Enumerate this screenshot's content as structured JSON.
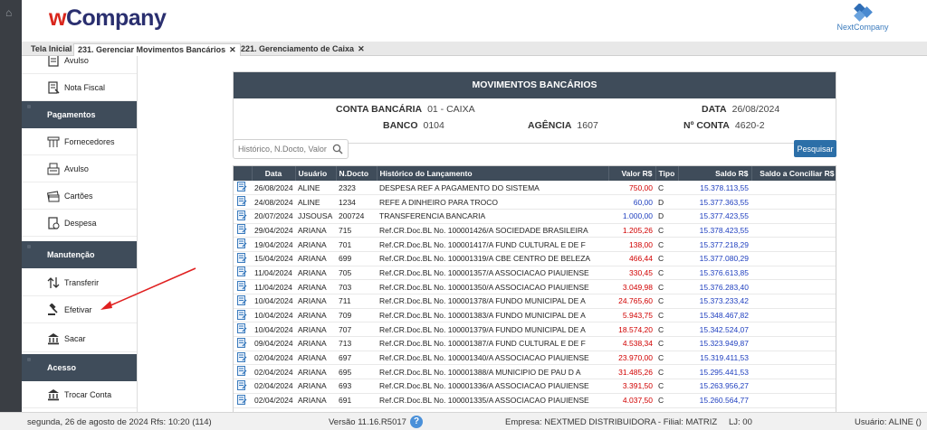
{
  "header": {
    "logo_w": "w",
    "logo_rest": "Company",
    "partner": "NextCompany"
  },
  "tabs": [
    {
      "label": "Tela Inicial"
    },
    {
      "label": "231. Gerenciar Movimentos Bancários",
      "close": "✕"
    },
    {
      "label": "221. Gerenciamento de Caixa",
      "close": "✕"
    }
  ],
  "sidebar": {
    "items": [
      {
        "label": "Avulso",
        "icon": "receipt-icon"
      },
      {
        "label": "Nota Fiscal",
        "icon": "invoice-icon"
      },
      {
        "label": "Pagamentos",
        "section": true
      },
      {
        "label": "Fornecedores",
        "icon": "supplier-icon"
      },
      {
        "label": "Avulso",
        "icon": "cash-register-icon"
      },
      {
        "label": "Cartões",
        "icon": "cards-icon"
      },
      {
        "label": "Despesa",
        "icon": "expense-icon"
      },
      {
        "label": "Manutenção",
        "section": true
      },
      {
        "label": "Transferir",
        "icon": "transfer-icon"
      },
      {
        "label": "Efetivar",
        "icon": "gavel-icon"
      },
      {
        "label": "Sacar",
        "icon": "bank-icon"
      },
      {
        "label": "Acesso",
        "section": true
      },
      {
        "label": "Trocar Conta",
        "icon": "bank-icon"
      }
    ]
  },
  "panel": {
    "title": "MOVIMENTOS BANCÁRIOS",
    "conta_label": "CONTA BANCÁRIA",
    "conta_value": "01 - CAIXA",
    "data_label": "DATA",
    "data_value": "26/08/2024",
    "banco_label": "BANCO",
    "banco_value": "0104",
    "agencia_label": "AGÊNCIA",
    "agencia_value": "1607",
    "nconta_label": "Nº CONTA",
    "nconta_value": "4620-2"
  },
  "search": {
    "placeholder": "Histórico, N.Docto, Valor",
    "button": "Pesquisar"
  },
  "table": {
    "columns": [
      "",
      "Data",
      "Usuário",
      "N.Docto",
      "Histórico do Lançamento",
      "Valor R$",
      "Tipo",
      "Saldo R$",
      "Saldo a Conciliar R$"
    ],
    "rows": [
      {
        "data": "26/08/2024",
        "usuario": "ALINE",
        "docto": "2323",
        "historico": "DESPESA REF A PAGAMENTO DO SISTEMA",
        "valor": "750,00",
        "tipo": "C",
        "saldo": "15.378.113,55",
        "conciliar": "",
        "neg": true
      },
      {
        "data": "24/08/2024",
        "usuario": "ALINE",
        "docto": "1234",
        "historico": "REFE A DINHEIRO PARA TROCO",
        "valor": "60,00",
        "tipo": "D",
        "saldo": "15.377.363,55",
        "conciliar": "",
        "neg": false
      },
      {
        "data": "20/07/2024",
        "usuario": "JJSOUSA",
        "docto": "200724",
        "historico": "TRANSFERENCIA BANCARIA",
        "valor": "1.000,00",
        "tipo": "D",
        "saldo": "15.377.423,55",
        "conciliar": "",
        "neg": false
      },
      {
        "data": "29/04/2024",
        "usuario": "ARIANA",
        "docto": "715",
        "historico": "Ref.CR.Doc.BL No. 100001426/A SOCIEDADE BRASILEIRA",
        "valor": "1.205,26",
        "tipo": "C",
        "saldo": "15.378.423,55",
        "conciliar": "",
        "neg": true
      },
      {
        "data": "19/04/2024",
        "usuario": "ARIANA",
        "docto": "701",
        "historico": "Ref.CR.Doc.BL No. 100001417/A FUND CULTURAL E DE F",
        "valor": "138,00",
        "tipo": "C",
        "saldo": "15.377.218,29",
        "conciliar": "",
        "neg": true
      },
      {
        "data": "15/04/2024",
        "usuario": "ARIANA",
        "docto": "699",
        "historico": "Ref.CR.Doc.BL No. 100001319/A CBE CENTRO DE BELEZA",
        "valor": "466,44",
        "tipo": "C",
        "saldo": "15.377.080,29",
        "conciliar": "",
        "neg": true
      },
      {
        "data": "11/04/2024",
        "usuario": "ARIANA",
        "docto": "705",
        "historico": "Ref.CR.Doc.BL No. 100001357/A ASSOCIACAO PIAUIENSE",
        "valor": "330,45",
        "tipo": "C",
        "saldo": "15.376.613,85",
        "conciliar": "",
        "neg": true
      },
      {
        "data": "11/04/2024",
        "usuario": "ARIANA",
        "docto": "703",
        "historico": "Ref.CR.Doc.BL No. 100001350/A ASSOCIACAO PIAUIENSE",
        "valor": "3.049,98",
        "tipo": "C",
        "saldo": "15.376.283,40",
        "conciliar": "",
        "neg": true
      },
      {
        "data": "10/04/2024",
        "usuario": "ARIANA",
        "docto": "711",
        "historico": "Ref.CR.Doc.BL No. 100001378/A FUNDO MUNICIPAL DE A",
        "valor": "24.765,60",
        "tipo": "C",
        "saldo": "15.373.233,42",
        "conciliar": "",
        "neg": true
      },
      {
        "data": "10/04/2024",
        "usuario": "ARIANA",
        "docto": "709",
        "historico": "Ref.CR.Doc.BL No. 100001383/A FUNDO MUNICIPAL DE A",
        "valor": "5.943,75",
        "tipo": "C",
        "saldo": "15.348.467,82",
        "conciliar": "",
        "neg": true
      },
      {
        "data": "10/04/2024",
        "usuario": "ARIANA",
        "docto": "707",
        "historico": "Ref.CR.Doc.BL No. 100001379/A FUNDO MUNICIPAL DE A",
        "valor": "18.574,20",
        "tipo": "C",
        "saldo": "15.342.524,07",
        "conciliar": "",
        "neg": true
      },
      {
        "data": "09/04/2024",
        "usuario": "ARIANA",
        "docto": "713",
        "historico": "Ref.CR.Doc.BL No. 100001387/A FUND CULTURAL E DE F",
        "valor": "4.538,34",
        "tipo": "C",
        "saldo": "15.323.949,87",
        "conciliar": "",
        "neg": true
      },
      {
        "data": "02/04/2024",
        "usuario": "ARIANA",
        "docto": "697",
        "historico": "Ref.CR.Doc.BL No. 100001340/A ASSOCIACAO PIAUIENSE",
        "valor": "23.970,00",
        "tipo": "C",
        "saldo": "15.319.411,53",
        "conciliar": "",
        "neg": true
      },
      {
        "data": "02/04/2024",
        "usuario": "ARIANA",
        "docto": "695",
        "historico": "Ref.CR.Doc.BL No. 100001388/A MUNICIPIO DE PAU D A",
        "valor": "31.485,26",
        "tipo": "C",
        "saldo": "15.295.441,53",
        "conciliar": "",
        "neg": true
      },
      {
        "data": "02/04/2024",
        "usuario": "ARIANA",
        "docto": "693",
        "historico": "Ref.CR.Doc.BL No. 100001336/A ASSOCIACAO PIAUIENSE",
        "valor": "3.391,50",
        "tipo": "C",
        "saldo": "15.263.956,27",
        "conciliar": "",
        "neg": true
      },
      {
        "data": "02/04/2024",
        "usuario": "ARIANA",
        "docto": "691",
        "historico": "Ref.CR.Doc.BL No. 100001335/A ASSOCIACAO PIAUIENSE",
        "valor": "4.037,50",
        "tipo": "C",
        "saldo": "15.260.564,77",
        "conciliar": "",
        "neg": true
      }
    ]
  },
  "footer": {
    "date": "segunda, 26 de agosto de 2024  Rfs: 10:20 (114)",
    "version": "Versão 11.16.R5017",
    "help": "?",
    "empresa": "Empresa: NEXTMED DISTRIBUIDORA - Filial: MATRIZ",
    "lj": "LJ: 00",
    "usuario": "Usuário: ALINE ()"
  },
  "colors": {
    "header_dark": "#3f4c5a",
    "negative": "#d10000",
    "positive": "#1f3fbf",
    "button": "#2c6fa8",
    "annotation_arrow": "#e02020"
  }
}
